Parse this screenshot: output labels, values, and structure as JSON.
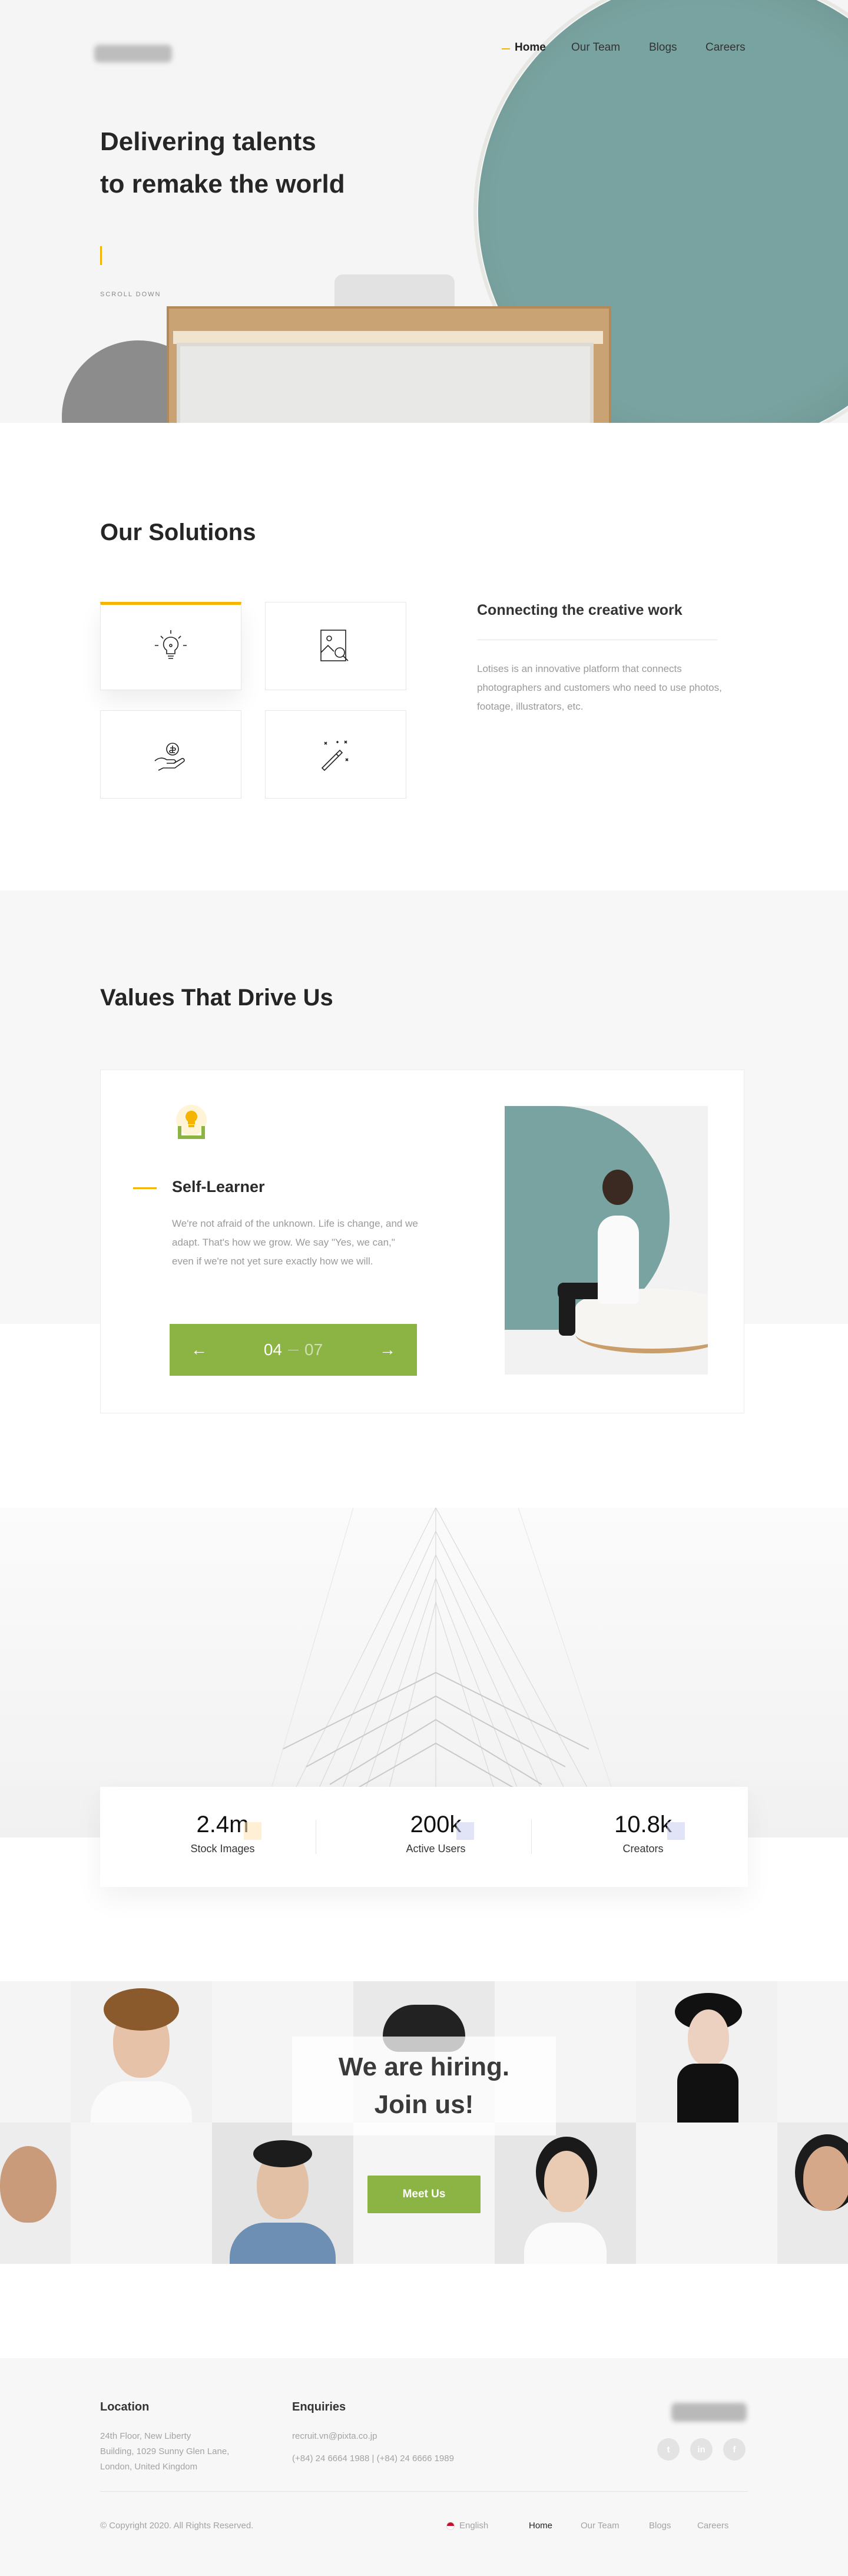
{
  "nav": {
    "items": [
      "Home",
      "Our Team",
      "Blogs",
      "Careers"
    ],
    "active": "Home"
  },
  "hero": {
    "title_line1": "Delivering talents",
    "title_line2": "to remake the world",
    "scroll_label": "SCROLL DOWN"
  },
  "solutions": {
    "title": "Our Solutions",
    "icons": [
      "lightbulb-icon",
      "image-search-icon",
      "hand-coin-icon",
      "magic-wand-icon"
    ],
    "heading": "Connecting the creative work",
    "text": "Lotises is an innovative platform that connects photographers and customers who need to use photos, footage, illustrators, etc."
  },
  "values": {
    "title": "Values That Drive Us",
    "card_title": "Self-Learner",
    "card_text": "We're not afraid of the unknown. Life is change, and we adapt. That's how we grow. We say \"Yes, we can,\" even if we're not yet sure exactly how we will.",
    "current": "04",
    "total": "07"
  },
  "stats": [
    {
      "value": "2.4m",
      "label": "Stock Images",
      "chip_color": "#ffe1b3"
    },
    {
      "value": "200k",
      "label": "Active Users",
      "chip_color": "#c9cef0"
    },
    {
      "value": "10.8k",
      "label": "Creators",
      "chip_color": "#c9cef0"
    }
  ],
  "hiring": {
    "title_line1": "We are hiring.",
    "title_line2": "Join us!",
    "button": "Meet Us"
  },
  "footer": {
    "location_title": "Location",
    "location_line1": "24th Floor, New Liberty",
    "location_line2": "Building, 1029 Sunny Glen Lane,",
    "location_line3": "London, United Kingdom",
    "enquiries_title": "Enquiries",
    "email": "recruit.vn@pixta.co.jp",
    "phones": "(+84) 24 6664 1988 | (+84) 24 6666 1989",
    "social": [
      "twitter-icon",
      "linkedin-icon",
      "facebook-icon"
    ],
    "copyright": "© Copyright 2020. All Rights Reserved.",
    "language": "English",
    "nav": [
      "Home",
      "Our Team",
      "Blogs",
      "Careers"
    ]
  },
  "colors": {
    "accent": "#f5b400",
    "green": "#8cb445",
    "teal": "#79a3a0"
  }
}
